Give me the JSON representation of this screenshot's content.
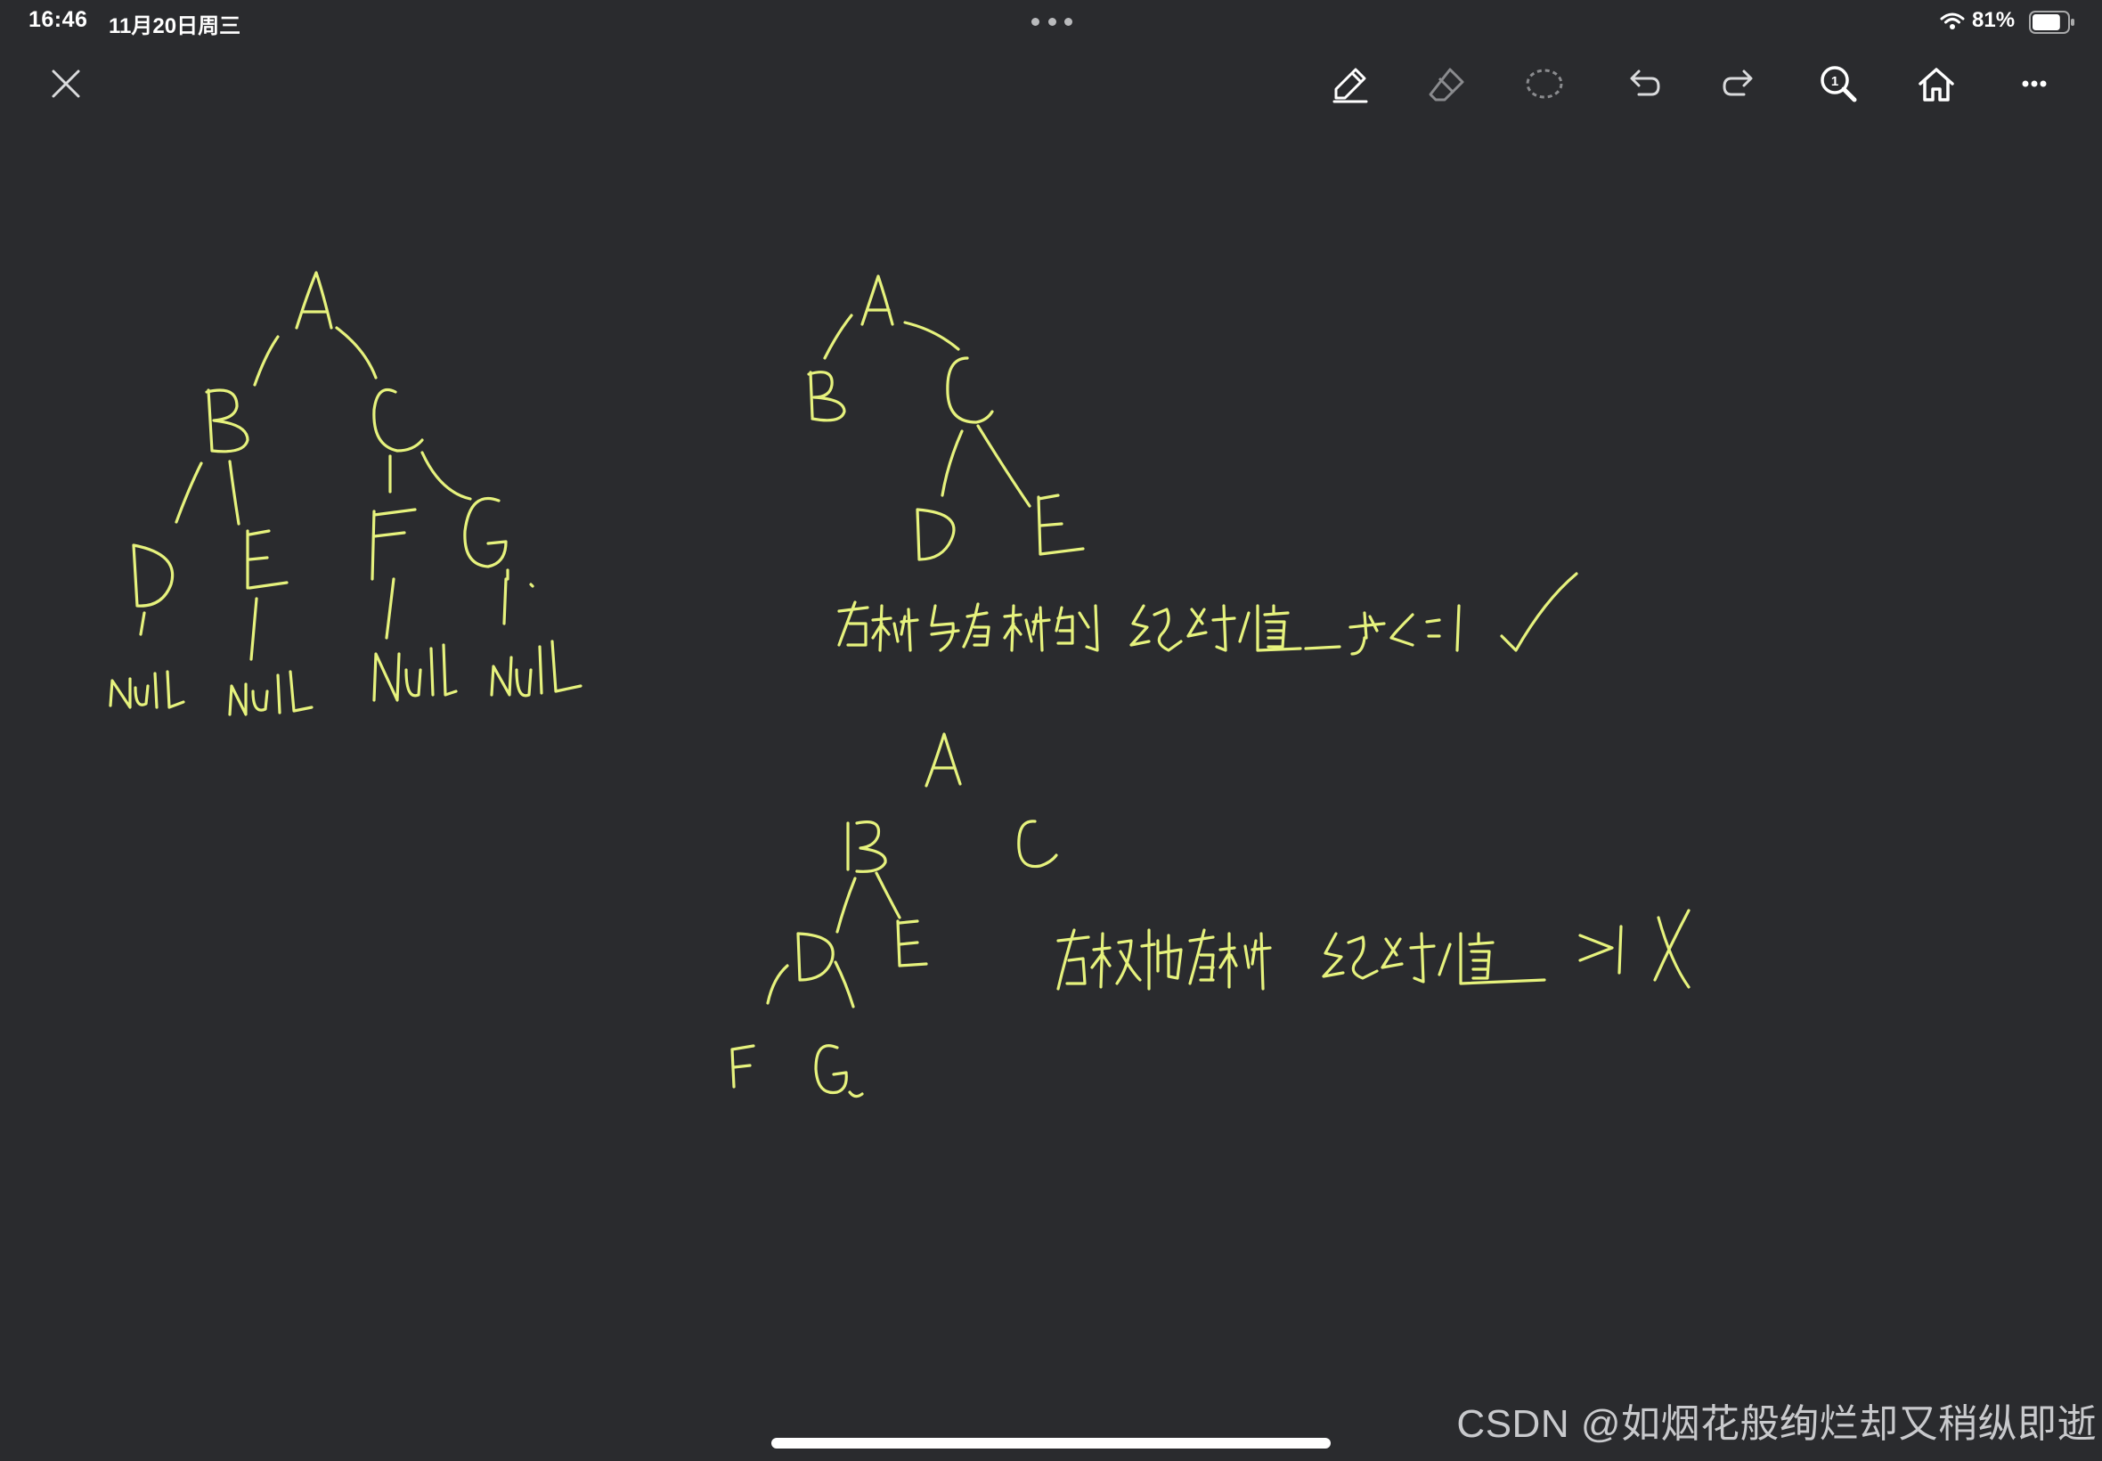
{
  "status_bar": {
    "time": "16:46",
    "date": "11月20日周三",
    "battery_percent": "81%",
    "battery_level": 0.81
  },
  "toolbar": {
    "icons": [
      "close-icon",
      "pen-icon",
      "eraser-icon",
      "lasso-icon",
      "undo-icon",
      "redo-icon",
      "zoom-icon",
      "home-icon",
      "more-icon"
    ],
    "zoom_badge": "1"
  },
  "colors": {
    "background": "#2a2b2e",
    "ink": "#e6f27d",
    "toolbar_icon": "#d9dadc",
    "toolbar_icon_dim": "#8a8b8e"
  },
  "watermark": "CSDN @如烟花般绚烂却又稍纵即逝",
  "handwriting": {
    "tree1": {
      "nodes": [
        "A",
        "B",
        "C",
        "D",
        "E",
        "F",
        "G"
      ],
      "nulls": [
        "NULL",
        "NULL",
        "NULL",
        "NULL"
      ]
    },
    "tree2": {
      "nodes": [
        "A",
        "B",
        "C",
        "D",
        "E"
      ],
      "note": "左树与右树的绝对值 为≤=1",
      "mark": "✓"
    },
    "tree3": {
      "nodes": [
        "A",
        "B",
        "C",
        "D",
        "E",
        "F",
        "G"
      ],
      "note": "左树和右树绝对值 >1",
      "mark": "X"
    }
  }
}
